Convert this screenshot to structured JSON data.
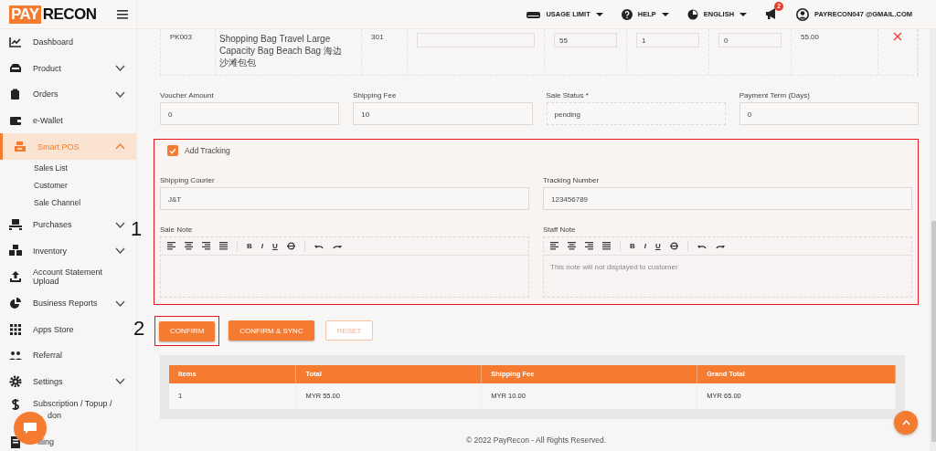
{
  "brand": {
    "part_1": "PAY",
    "part_2": "RECON"
  },
  "topbar": [
    {
      "kind": "usage",
      "label": "USAGE LIMIT",
      "dropdown": true
    },
    {
      "kind": "help",
      "label": "HELP",
      "dropdown": true
    },
    {
      "kind": "language",
      "label": "ENGLISH",
      "dropdown": true
    },
    {
      "kind": "announce",
      "badge": "2",
      "dropdown": false
    },
    {
      "kind": "user",
      "label": "PAYRECON047 @GMAIL.COM",
      "dropdown": false
    }
  ],
  "sidebar": {
    "items": [
      {
        "label": "Dashboard",
        "expandable": false,
        "selected": false
      },
      {
        "label": "Product",
        "expandable": true,
        "expanded": false,
        "selected": false
      },
      {
        "label": "Orders",
        "expandable": true,
        "expanded": false,
        "selected": false
      },
      {
        "label": "e-Wallet",
        "expandable": false,
        "selected": false
      },
      {
        "label": "Smart POS",
        "expandable": true,
        "expanded": true,
        "selected": true,
        "children": [
          {
            "label": "Sales List"
          },
          {
            "label": "Customer"
          },
          {
            "label": "Sale Channel"
          }
        ]
      },
      {
        "label": "Purchases",
        "expandable": true,
        "expanded": false,
        "selected": false
      },
      {
        "label": "Inventory",
        "expandable": true,
        "expanded": false,
        "selected": false
      },
      {
        "label": "Account Statement Upload",
        "expandable": false,
        "selected": false
      },
      {
        "label": "Business Reports",
        "expandable": true,
        "expanded": false,
        "selected": false
      },
      {
        "label": "Apps Store",
        "expandable": false,
        "selected": false
      },
      {
        "label": "Referral",
        "expandable": false,
        "selected": false
      },
      {
        "label": "Settings",
        "expandable": true,
        "expanded": false,
        "selected": false
      },
      {
        "label": "Subscription / Topup /",
        "label_cut": "don",
        "expandable": false,
        "selected": false
      },
      {
        "label_cut": "illing",
        "expandable": false,
        "selected": false
      }
    ]
  },
  "product_row": [
    {
      "kind": "text",
      "text": "PK003"
    },
    {
      "kind": "lines",
      "lines": [
        "Shopping Bag Travel Large",
        "Capacity Bag Beach Bag 海边",
        "沙滩包包"
      ]
    },
    {
      "kind": "text",
      "text": "301"
    },
    {
      "kind": "input"
    },
    {
      "kind": "input",
      "value": "55"
    },
    {
      "kind": "input",
      "value": "1"
    },
    {
      "kind": "input",
      "value": "0"
    },
    {
      "kind": "text",
      "text": "55.00"
    },
    {
      "kind": "remove"
    }
  ],
  "fields": [
    {
      "label": "Voucher Amount",
      "value": "0"
    },
    {
      "label": "Shipping Fee",
      "value": "10"
    },
    {
      "label": "Sale Status *",
      "value": "pending"
    },
    {
      "label": "Payment Term (Days)",
      "value": "0"
    }
  ],
  "tracking": {
    "annotation": "1",
    "checkbox": {
      "label": "Add Tracking",
      "checked": true
    },
    "fields": [
      {
        "label": "Shipping Courier",
        "value": "J&T"
      },
      {
        "label": "Tracking Number",
        "value": "123456789"
      }
    ],
    "notes": [
      {
        "label": "Sale Note",
        "format_keys": [
          "B",
          "I",
          "U"
        ]
      },
      {
        "label": "Staff Note",
        "format_keys": [
          "B",
          "I",
          "U"
        ],
        "placeholder": "This note will not displayed to customer"
      }
    ]
  },
  "buttons": [
    {
      "label": "CONFIRM",
      "kind": "primary",
      "annotation": "2"
    },
    {
      "label": "CONFIRM & SYNC",
      "kind": "primary"
    },
    {
      "label": "RESET",
      "kind": "outline"
    }
  ],
  "summary": {
    "columns": [
      "Items",
      "Total",
      "Shipping Fee",
      "Grand Total"
    ],
    "rows": [
      [
        "1",
        "MYR 55.00",
        "MYR 10.00",
        "MYR 65.00"
      ]
    ]
  },
  "footer": "© 2022 PayRecon - All Rights Reserved."
}
